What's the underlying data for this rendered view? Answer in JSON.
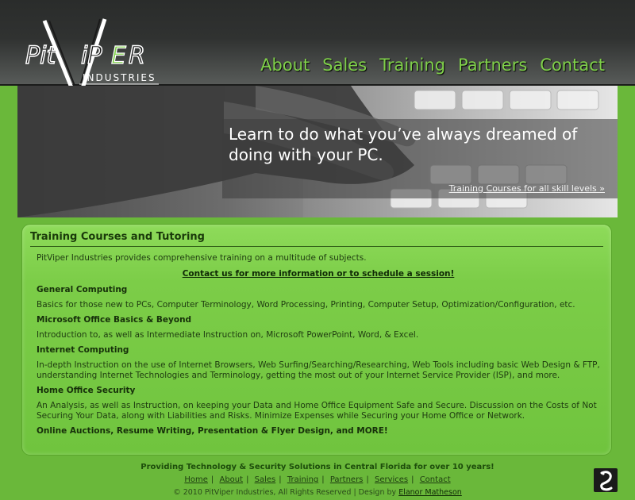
{
  "logo": {
    "text_top": "PitViper",
    "text_bottom": "Industries"
  },
  "nav": {
    "items": [
      "About",
      "Sales",
      "Training",
      "Partners",
      "Contact"
    ]
  },
  "hero": {
    "heading": "Learn to do what you’ve always dreamed of doing with your PC.",
    "link": "Training Courses for all skill levels »"
  },
  "content": {
    "title": "Training Courses and Tutoring",
    "intro": "PitViper Industries provides comprehensive training on a multitude of subjects.",
    "contact_link": "Contact us for more information or to schedule a session!",
    "sections": [
      {
        "title": "General Computing",
        "desc": "Basics for those new to PCs, Computer Terminology, Word Processing, Printing, Computer Setup, Optimization/Configuration, etc."
      },
      {
        "title": "Microsoft Office Basics & Beyond",
        "desc": "Introduction to, as well as Intermediate Instruction on, Microsoft PowerPoint, Word, & Excel."
      },
      {
        "title": "Internet Computing",
        "desc": "In-depth Instruction on the use of Internet Browsers, Web Surfing/Searching/Researching, Web Tools including basic Web Design & FTP, understanding Internet Technologies and Terminology, getting the most out of your Internet Service Provider (ISP), and more."
      },
      {
        "title": "Home Office Security",
        "desc": "An Analysis, as well as Instruction, on keeping your Data and Home Office Equipment Safe and Secure. Discussion on the Costs of Not Securing Your Data, along with Liabilities and Risks. Minimize Expenses while Securing your Home Office or Network."
      }
    ],
    "final": "Online Auctions, Resume Writing, Presentation & Flyer Design, and MORE!"
  },
  "footer": {
    "tagline": "Providing Technology & Security Solutions in Central Florida for over 10 years!",
    "links": [
      "Home",
      "About",
      "Sales",
      "Training",
      "Partners",
      "Services",
      "Contact"
    ],
    "copyright_prefix": "© 2010 PitViper Industries, All Rights Reserved | Design by ",
    "designer": "Elanor Matheson"
  }
}
